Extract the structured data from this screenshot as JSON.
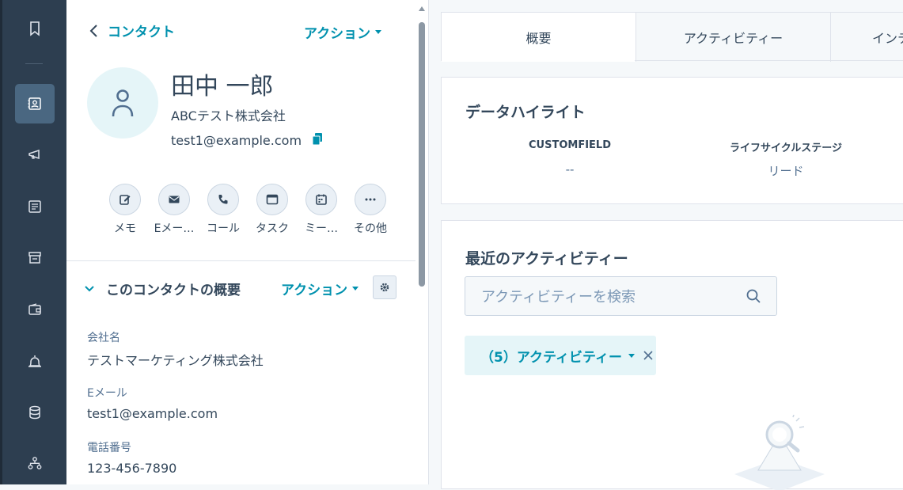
{
  "rail": {
    "icons": [
      "bookmark-icon",
      "contacts-icon",
      "megaphone-icon",
      "document-icon",
      "store-icon",
      "wallet-icon",
      "bell-icon",
      "database-icon",
      "org-chart-icon"
    ]
  },
  "contact": {
    "back_label": "コンタクト",
    "actions_label": "アクション",
    "name": "田中 一郎",
    "company": "ABCテスト株式会社",
    "email": "test1@example.com"
  },
  "quick_actions": [
    {
      "label": "メモ",
      "icon": "note-icon"
    },
    {
      "label": "Eメー…",
      "icon": "email-icon"
    },
    {
      "label": "コール",
      "icon": "phone-icon"
    },
    {
      "label": "タスク",
      "icon": "task-icon"
    },
    {
      "label": "ミー…",
      "icon": "calendar-icon"
    },
    {
      "label": "その他",
      "icon": "more-icon"
    }
  ],
  "overview": {
    "title": "このコンタクトの概要",
    "actions_label": "アクション",
    "properties": [
      {
        "label": "会社名",
        "value": "テストマーケティング株式会社"
      },
      {
        "label": "Eメール",
        "value": "test1@example.com"
      },
      {
        "label": "電話番号",
        "value": "123-456-7890"
      }
    ]
  },
  "tabs": [
    "概要",
    "アクティビティー",
    "インテ"
  ],
  "highlights": {
    "title": "データハイライト",
    "fields": [
      {
        "label": "CUSTOMFIELD",
        "value": "--"
      },
      {
        "label": "ライフサイクルステージ",
        "value": "リード"
      }
    ]
  },
  "recent": {
    "title": "最近のアクティビティー",
    "search_placeholder": "アクティビティーを検索",
    "filter_label": "（5）アクティビティー"
  },
  "colors": {
    "accent": "#0091ae",
    "rail_bg": "#2d3e50",
    "rail_active": "#4a6781",
    "text": "#33475b"
  }
}
